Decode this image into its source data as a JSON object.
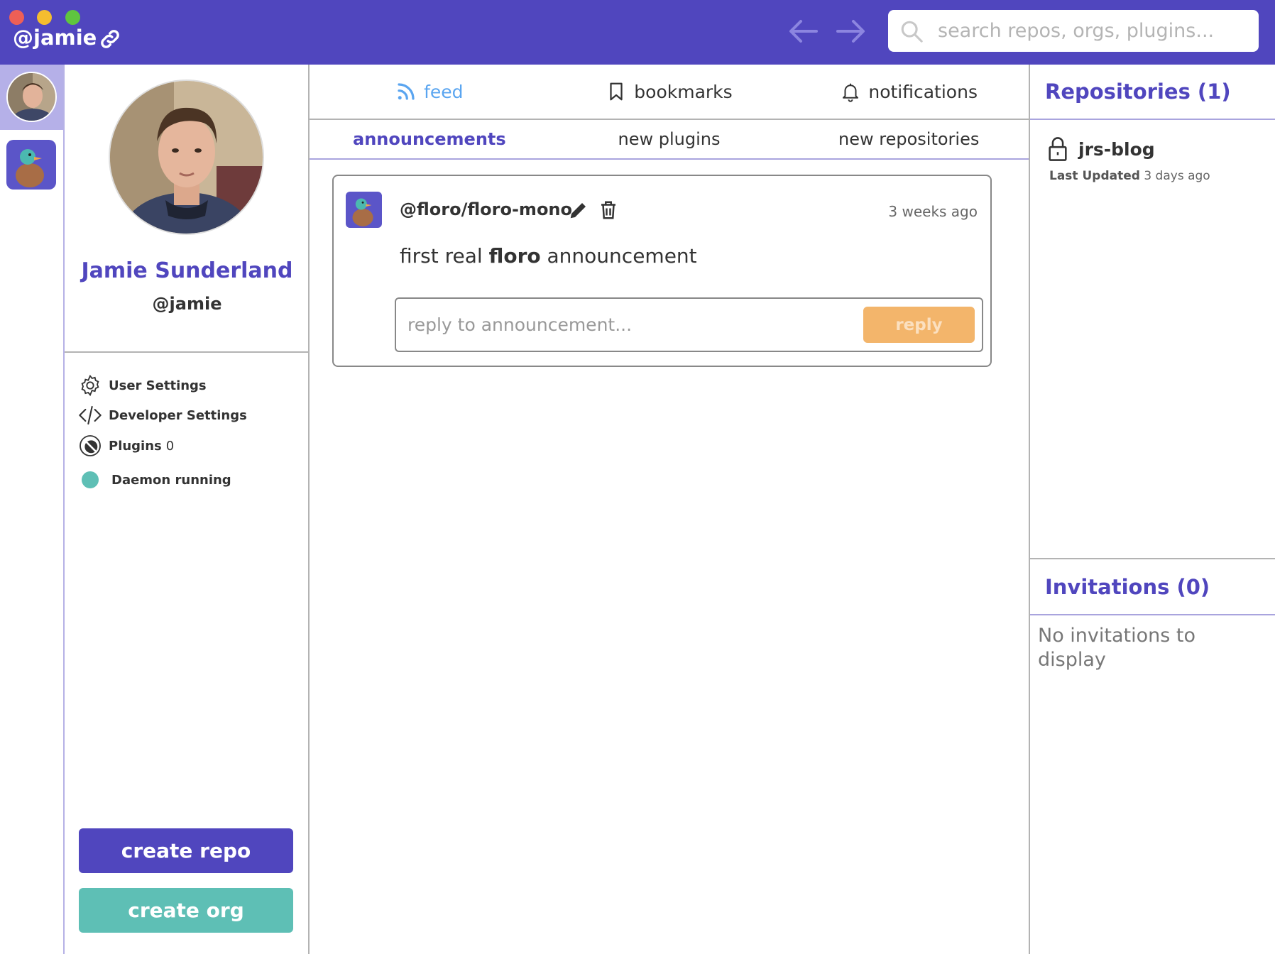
{
  "window": {
    "user_handle": "@jamie"
  },
  "search": {
    "placeholder": "search repos, orgs, plugins..."
  },
  "profile": {
    "name": "Jamie Sunderland",
    "handle": "@jamie"
  },
  "menu": {
    "user_settings": "User Settings",
    "developer_settings": "Developer Settings",
    "plugins_label": "Plugins",
    "plugins_count": "0",
    "daemon_status": "Daemon running"
  },
  "actions": {
    "create_repo": "create repo",
    "create_org": "create org"
  },
  "tabs": {
    "feed": "feed",
    "bookmarks": "bookmarks",
    "notifications": "notifications"
  },
  "subtabs": {
    "announcements": "announcements",
    "new_plugins": "new plugins",
    "new_repositories": "new repositories"
  },
  "announcement": {
    "author": "@floro/floro-mono",
    "time": "3 weeks ago",
    "text_before": "first real ",
    "text_bold": "floro",
    "text_after": " announcement",
    "reply_placeholder": "reply to announcement...",
    "reply_button": "reply"
  },
  "repositories": {
    "title": "Repositories (1)",
    "items": [
      {
        "name": "jrs-blog",
        "updated_label": "Last Updated",
        "updated_value": "3 days ago"
      }
    ]
  },
  "invitations": {
    "title": "Invitations (0)",
    "empty_text": "No invitations to display"
  },
  "colors": {
    "brand": "#5046be",
    "teal": "#5ebfb5",
    "reply_orange": "#f3b56b",
    "feed_blue": "#5aa5f0"
  }
}
